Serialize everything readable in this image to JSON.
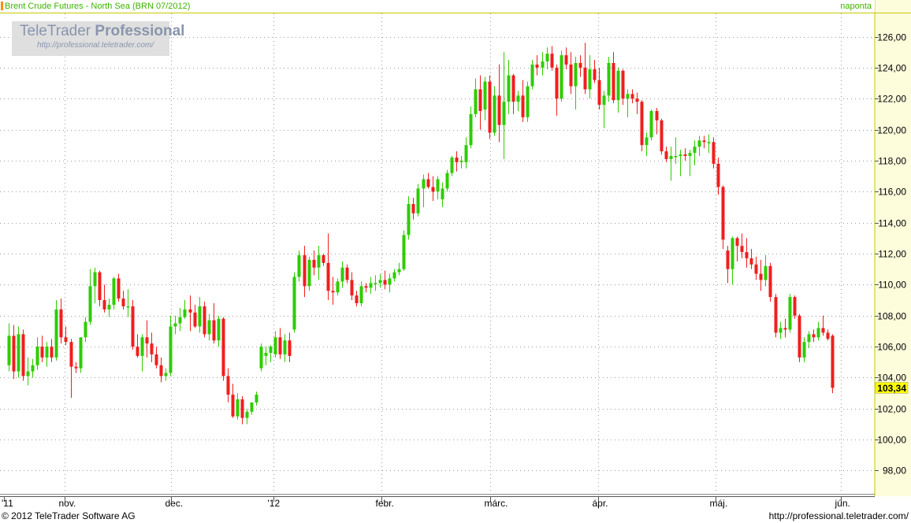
{
  "header": {
    "title": "Brent Crude Futures - North Sea (BRN 07/2012)",
    "frequency": "naponta"
  },
  "logo": {
    "name_light": "TeleTrader ",
    "name_bold": "Professional",
    "url": "http://professional.teletrader.com/"
  },
  "footer": {
    "copyright": "© 2012 TeleTrader Software AG",
    "url": "http://professional.teletrader.com/"
  },
  "colors": {
    "up": "#2ecc00",
    "down": "#f01e1e",
    "grid": "#9a9a9a",
    "axis_band": "#fdfddc",
    "axis_border": "#c8c800",
    "last_price_box": "#ffff00",
    "accent": "#ff8c00"
  },
  "chart_data": {
    "type": "candlestick",
    "title": "Brent Crude Futures - North Sea (BRN 07/2012)",
    "y_axis_side": "right",
    "ylim": [
      96.5,
      127.5
    ],
    "y_ticks": [
      "98,00",
      "100,00",
      "102,00",
      "104,00",
      "106,00",
      "108,00",
      "110,00",
      "112,00",
      "114,00",
      "116,00",
      "118,00",
      "120,00",
      "122,00",
      "124,00",
      "126,00"
    ],
    "x_ticks": [
      "'11",
      "nov.",
      "dec.",
      "'12",
      "febr.",
      "márc.",
      "ápr.",
      "máj.",
      "jún."
    ],
    "last_price": "103,34",
    "last_value": 103.34,
    "grid": true,
    "candles": [
      {
        "o": 104.8,
        "h": 107.5,
        "l": 104.4,
        "c": 106.7
      },
      {
        "o": 106.7,
        "h": 107.4,
        "l": 103.9,
        "c": 104.4
      },
      {
        "o": 104.4,
        "h": 107.3,
        "l": 104.0,
        "c": 106.8
      },
      {
        "o": 106.8,
        "h": 107.1,
        "l": 103.8,
        "c": 104.1
      },
      {
        "o": 104.1,
        "h": 105.3,
        "l": 103.5,
        "c": 104.4
      },
      {
        "o": 104.4,
        "h": 105.2,
        "l": 104.0,
        "c": 104.8
      },
      {
        "o": 104.8,
        "h": 106.6,
        "l": 104.5,
        "c": 106.0
      },
      {
        "o": 106.0,
        "h": 106.7,
        "l": 105.0,
        "c": 105.3
      },
      {
        "o": 105.3,
        "h": 106.3,
        "l": 104.7,
        "c": 106.0
      },
      {
        "o": 106.0,
        "h": 106.5,
        "l": 105.0,
        "c": 105.3
      },
      {
        "o": 105.3,
        "h": 109.0,
        "l": 105.1,
        "c": 108.4
      },
      {
        "o": 108.4,
        "h": 109.1,
        "l": 106.2,
        "c": 106.6
      },
      {
        "o": 106.6,
        "h": 107.3,
        "l": 106.1,
        "c": 106.3
      },
      {
        "o": 106.3,
        "h": 106.5,
        "l": 102.7,
        "c": 104.7
      },
      {
        "o": 104.7,
        "h": 105.0,
        "l": 104.3,
        "c": 104.6
      },
      {
        "o": 104.6,
        "h": 106.6,
        "l": 104.3,
        "c": 106.6
      },
      {
        "o": 106.6,
        "h": 107.9,
        "l": 106.3,
        "c": 107.6
      },
      {
        "o": 107.6,
        "h": 111.0,
        "l": 107.4,
        "c": 109.9
      },
      {
        "o": 109.9,
        "h": 111.1,
        "l": 108.8,
        "c": 110.8
      },
      {
        "o": 110.8,
        "h": 110.9,
        "l": 108.6,
        "c": 109.0
      },
      {
        "o": 109.0,
        "h": 110.0,
        "l": 108.2,
        "c": 108.4
      },
      {
        "o": 108.4,
        "h": 109.1,
        "l": 107.9,
        "c": 108.7
      },
      {
        "o": 108.7,
        "h": 110.5,
        "l": 108.4,
        "c": 110.4
      },
      {
        "o": 110.4,
        "h": 110.7,
        "l": 108.9,
        "c": 109.1
      },
      {
        "o": 109.1,
        "h": 109.6,
        "l": 108.4,
        "c": 108.6
      },
      {
        "o": 108.6,
        "h": 109.7,
        "l": 107.9,
        "c": 108.6
      },
      {
        "o": 108.6,
        "h": 109.0,
        "l": 105.8,
        "c": 106.0
      },
      {
        "o": 106.0,
        "h": 106.8,
        "l": 105.3,
        "c": 105.4
      },
      {
        "o": 105.4,
        "h": 106.8,
        "l": 104.4,
        "c": 106.6
      },
      {
        "o": 106.6,
        "h": 107.7,
        "l": 105.3,
        "c": 106.2
      },
      {
        "o": 106.2,
        "h": 106.9,
        "l": 105.0,
        "c": 105.5
      },
      {
        "o": 105.5,
        "h": 106.0,
        "l": 104.6,
        "c": 104.8
      },
      {
        "o": 104.8,
        "h": 105.3,
        "l": 103.7,
        "c": 104.1
      },
      {
        "o": 104.1,
        "h": 104.6,
        "l": 103.8,
        "c": 104.3
      },
      {
        "o": 104.3,
        "h": 108.0,
        "l": 104.1,
        "c": 107.3
      },
      {
        "o": 107.3,
        "h": 108.0,
        "l": 106.8,
        "c": 107.5
      },
      {
        "o": 107.5,
        "h": 108.5,
        "l": 107.0,
        "c": 107.9
      },
      {
        "o": 107.9,
        "h": 109.0,
        "l": 107.8,
        "c": 108.4
      },
      {
        "o": 108.4,
        "h": 109.3,
        "l": 107.0,
        "c": 108.2
      },
      {
        "o": 108.2,
        "h": 108.7,
        "l": 107.2,
        "c": 107.3
      },
      {
        "o": 107.3,
        "h": 109.2,
        "l": 106.9,
        "c": 108.6
      },
      {
        "o": 108.6,
        "h": 108.9,
        "l": 106.6,
        "c": 106.8
      },
      {
        "o": 106.8,
        "h": 108.1,
        "l": 106.4,
        "c": 107.7
      },
      {
        "o": 107.7,
        "h": 108.8,
        "l": 106.2,
        "c": 106.4
      },
      {
        "o": 106.4,
        "h": 108.0,
        "l": 106.0,
        "c": 107.8
      },
      {
        "o": 107.8,
        "h": 107.9,
        "l": 103.8,
        "c": 104.1
      },
      {
        "o": 104.1,
        "h": 104.6,
        "l": 102.4,
        "c": 102.9
      },
      {
        "o": 102.9,
        "h": 103.6,
        "l": 101.4,
        "c": 101.5
      },
      {
        "o": 101.5,
        "h": 103.0,
        "l": 101.3,
        "c": 102.6
      },
      {
        "o": 102.6,
        "h": 102.8,
        "l": 101.0,
        "c": 101.4
      },
      {
        "o": 101.4,
        "h": 102.0,
        "l": 101.0,
        "c": 101.8
      },
      {
        "o": 101.8,
        "h": 102.4,
        "l": 101.6,
        "c": 102.4
      },
      {
        "o": 102.4,
        "h": 103.1,
        "l": 102.2,
        "c": 102.9
      },
      {
        "o": 104.6,
        "h": 106.2,
        "l": 104.4,
        "c": 106.0
      },
      {
        "o": 105.4,
        "h": 106.0,
        "l": 104.8,
        "c": 105.6
      },
      {
        "o": 105.6,
        "h": 106.1,
        "l": 105.0,
        "c": 106.0
      },
      {
        "o": 105.5,
        "h": 107.0,
        "l": 105.3,
        "c": 106.6
      },
      {
        "o": 106.6,
        "h": 107.2,
        "l": 105.2,
        "c": 105.5
      },
      {
        "o": 105.5,
        "h": 106.8,
        "l": 105.0,
        "c": 106.4
      },
      {
        "o": 106.4,
        "h": 106.9,
        "l": 105.0,
        "c": 105.4
      },
      {
        "o": 107.1,
        "h": 110.8,
        "l": 106.9,
        "c": 110.5
      },
      {
        "o": 110.5,
        "h": 112.2,
        "l": 110.2,
        "c": 111.9
      },
      {
        "o": 111.9,
        "h": 112.5,
        "l": 109.2,
        "c": 109.9
      },
      {
        "o": 109.9,
        "h": 111.8,
        "l": 109.6,
        "c": 111.6
      },
      {
        "o": 111.6,
        "h": 112.2,
        "l": 110.6,
        "c": 111.1
      },
      {
        "o": 111.1,
        "h": 112.5,
        "l": 110.3,
        "c": 111.9
      },
      {
        "o": 111.9,
        "h": 112.0,
        "l": 111.2,
        "c": 111.4
      },
      {
        "o": 111.4,
        "h": 113.3,
        "l": 109.0,
        "c": 109.6
      },
      {
        "o": 109.6,
        "h": 110.5,
        "l": 108.7,
        "c": 109.5
      },
      {
        "o": 109.5,
        "h": 110.4,
        "l": 109.3,
        "c": 110.2
      },
      {
        "o": 110.2,
        "h": 111.5,
        "l": 109.8,
        "c": 111.1
      },
      {
        "o": 111.1,
        "h": 111.3,
        "l": 110.1,
        "c": 110.3
      },
      {
        "o": 110.3,
        "h": 110.8,
        "l": 109.0,
        "c": 109.3
      },
      {
        "o": 109.3,
        "h": 109.6,
        "l": 108.6,
        "c": 108.8
      },
      {
        "o": 108.8,
        "h": 110.2,
        "l": 108.6,
        "c": 109.9
      },
      {
        "o": 109.9,
        "h": 110.1,
        "l": 109.5,
        "c": 109.8
      },
      {
        "o": 109.8,
        "h": 110.5,
        "l": 109.4,
        "c": 110.1
      },
      {
        "o": 110.1,
        "h": 110.6,
        "l": 109.6,
        "c": 110.1
      },
      {
        "o": 110.1,
        "h": 110.7,
        "l": 109.8,
        "c": 110.3
      },
      {
        "o": 110.3,
        "h": 110.9,
        "l": 109.7,
        "c": 110.0
      },
      {
        "o": 110.0,
        "h": 110.7,
        "l": 109.5,
        "c": 110.4
      },
      {
        "o": 110.4,
        "h": 111.0,
        "l": 110.2,
        "c": 110.8
      },
      {
        "o": 110.8,
        "h": 111.4,
        "l": 110.6,
        "c": 111.0
      },
      {
        "o": 111.0,
        "h": 113.5,
        "l": 110.9,
        "c": 113.2
      },
      {
        "o": 113.2,
        "h": 115.7,
        "l": 112.9,
        "c": 115.2
      },
      {
        "o": 115.2,
        "h": 115.6,
        "l": 114.2,
        "c": 114.6
      },
      {
        "o": 114.6,
        "h": 116.5,
        "l": 114.4,
        "c": 116.2
      },
      {
        "o": 116.2,
        "h": 117.1,
        "l": 115.0,
        "c": 116.8
      },
      {
        "o": 116.8,
        "h": 117.2,
        "l": 116.2,
        "c": 116.3
      },
      {
        "o": 116.3,
        "h": 117.0,
        "l": 115.4,
        "c": 116.0
      },
      {
        "o": 116.0,
        "h": 117.0,
        "l": 115.5,
        "c": 116.8
      },
      {
        "o": 115.5,
        "h": 116.6,
        "l": 115.0,
        "c": 116.2
      },
      {
        "o": 116.2,
        "h": 117.4,
        "l": 116.0,
        "c": 117.2
      },
      {
        "o": 117.2,
        "h": 118.3,
        "l": 117.0,
        "c": 118.2
      },
      {
        "o": 118.2,
        "h": 118.6,
        "l": 117.3,
        "c": 117.9
      },
      {
        "o": 117.9,
        "h": 118.3,
        "l": 117.5,
        "c": 118.0
      },
      {
        "o": 117.9,
        "h": 119.5,
        "l": 117.5,
        "c": 119.0
      },
      {
        "o": 119.0,
        "h": 121.5,
        "l": 118.8,
        "c": 121.0
      },
      {
        "o": 121.0,
        "h": 123.3,
        "l": 120.8,
        "c": 122.6
      },
      {
        "o": 122.6,
        "h": 123.5,
        "l": 120.0,
        "c": 121.2
      },
      {
        "o": 121.3,
        "h": 123.4,
        "l": 120.6,
        "c": 123.1
      },
      {
        "o": 123.1,
        "h": 123.5,
        "l": 119.4,
        "c": 119.8
      },
      {
        "o": 119.8,
        "h": 122.8,
        "l": 119.6,
        "c": 122.2
      },
      {
        "o": 122.2,
        "h": 124.2,
        "l": 119.2,
        "c": 120.3
      },
      {
        "o": 120.3,
        "h": 125.0,
        "l": 118.1,
        "c": 121.8
      },
      {
        "o": 121.8,
        "h": 124.5,
        "l": 121.0,
        "c": 123.5
      },
      {
        "o": 123.5,
        "h": 123.6,
        "l": 121.0,
        "c": 121.8
      },
      {
        "o": 121.8,
        "h": 122.5,
        "l": 121.2,
        "c": 122.2
      },
      {
        "o": 122.2,
        "h": 123.2,
        "l": 120.5,
        "c": 120.8
      },
      {
        "o": 120.8,
        "h": 123.1,
        "l": 120.5,
        "c": 122.8
      },
      {
        "o": 122.8,
        "h": 124.5,
        "l": 122.6,
        "c": 124.2
      },
      {
        "o": 124.2,
        "h": 124.8,
        "l": 123.5,
        "c": 124.0
      },
      {
        "o": 124.0,
        "h": 125.0,
        "l": 123.5,
        "c": 124.4
      },
      {
        "o": 124.4,
        "h": 125.3,
        "l": 123.9,
        "c": 124.9
      },
      {
        "o": 124.9,
        "h": 125.4,
        "l": 123.8,
        "c": 124.0
      },
      {
        "o": 124.0,
        "h": 124.2,
        "l": 120.9,
        "c": 122.0
      },
      {
        "o": 122.0,
        "h": 125.1,
        "l": 121.8,
        "c": 124.8
      },
      {
        "o": 124.8,
        "h": 125.3,
        "l": 123.9,
        "c": 124.2
      },
      {
        "o": 124.2,
        "h": 125.0,
        "l": 122.3,
        "c": 122.8
      },
      {
        "o": 122.8,
        "h": 124.7,
        "l": 121.3,
        "c": 124.3
      },
      {
        "o": 124.3,
        "h": 124.8,
        "l": 123.4,
        "c": 124.0
      },
      {
        "o": 124.0,
        "h": 125.6,
        "l": 122.3,
        "c": 122.6
      },
      {
        "o": 122.6,
        "h": 124.8,
        "l": 122.0,
        "c": 123.9
      },
      {
        "o": 123.9,
        "h": 124.5,
        "l": 123.0,
        "c": 123.2
      },
      {
        "o": 123.2,
        "h": 124.0,
        "l": 121.3,
        "c": 121.6
      },
      {
        "o": 121.6,
        "h": 122.5,
        "l": 120.1,
        "c": 122.2
      },
      {
        "o": 122.2,
        "h": 124.7,
        "l": 121.8,
        "c": 124.3
      },
      {
        "o": 124.3,
        "h": 125.0,
        "l": 121.7,
        "c": 121.9
      },
      {
        "o": 121.9,
        "h": 124.0,
        "l": 121.1,
        "c": 123.8
      },
      {
        "o": 123.8,
        "h": 123.9,
        "l": 121.6,
        "c": 122.0
      },
      {
        "o": 122.0,
        "h": 122.6,
        "l": 120.8,
        "c": 122.3
      },
      {
        "o": 122.3,
        "h": 122.6,
        "l": 121.7,
        "c": 122.0
      },
      {
        "o": 122.0,
        "h": 122.4,
        "l": 121.0,
        "c": 121.8
      },
      {
        "o": 121.8,
        "h": 121.9,
        "l": 118.6,
        "c": 119.0
      },
      {
        "o": 119.0,
        "h": 119.8,
        "l": 118.3,
        "c": 119.5
      },
      {
        "o": 119.5,
        "h": 121.3,
        "l": 119.3,
        "c": 121.2
      },
      {
        "o": 121.2,
        "h": 121.4,
        "l": 119.7,
        "c": 120.6
      },
      {
        "o": 120.6,
        "h": 120.7,
        "l": 118.4,
        "c": 118.6
      },
      {
        "o": 118.6,
        "h": 118.9,
        "l": 117.9,
        "c": 118.1
      },
      {
        "o": 118.1,
        "h": 118.9,
        "l": 116.7,
        "c": 118.3
      },
      {
        "o": 118.3,
        "h": 119.5,
        "l": 117.8,
        "c": 118.3
      },
      {
        "o": 118.3,
        "h": 118.7,
        "l": 117.0,
        "c": 118.4
      },
      {
        "o": 118.4,
        "h": 118.8,
        "l": 118.0,
        "c": 118.3
      },
      {
        "o": 118.3,
        "h": 118.7,
        "l": 117.0,
        "c": 118.5
      },
      {
        "o": 118.5,
        "h": 119.3,
        "l": 117.7,
        "c": 118.9
      },
      {
        "o": 118.9,
        "h": 119.6,
        "l": 118.3,
        "c": 119.3
      },
      {
        "o": 119.3,
        "h": 119.6,
        "l": 118.8,
        "c": 119.2
      },
      {
        "o": 119.2,
        "h": 119.7,
        "l": 118.5,
        "c": 119.2
      },
      {
        "o": 119.2,
        "h": 119.5,
        "l": 117.5,
        "c": 117.8
      },
      {
        "o": 117.8,
        "h": 118.2,
        "l": 115.8,
        "c": 116.3
      },
      {
        "o": 116.3,
        "h": 116.4,
        "l": 112.3,
        "c": 112.9
      },
      {
        "o": 112.2,
        "h": 112.5,
        "l": 110.1,
        "c": 111.0
      },
      {
        "o": 111.0,
        "h": 113.1,
        "l": 110.0,
        "c": 113.0
      },
      {
        "o": 113.0,
        "h": 113.1,
        "l": 111.5,
        "c": 112.5
      },
      {
        "o": 112.5,
        "h": 113.3,
        "l": 111.7,
        "c": 112.1
      },
      {
        "o": 112.1,
        "h": 113.0,
        "l": 111.1,
        "c": 111.7
      },
      {
        "o": 111.7,
        "h": 112.3,
        "l": 111.0,
        "c": 111.3
      },
      {
        "o": 111.3,
        "h": 111.8,
        "l": 110.3,
        "c": 110.7
      },
      {
        "o": 110.7,
        "h": 111.6,
        "l": 109.6,
        "c": 110.3
      },
      {
        "o": 110.3,
        "h": 111.9,
        "l": 109.9,
        "c": 111.2
      },
      {
        "o": 111.2,
        "h": 111.4,
        "l": 108.9,
        "c": 109.2
      },
      {
        "o": 109.2,
        "h": 109.4,
        "l": 106.6,
        "c": 106.9
      },
      {
        "o": 106.9,
        "h": 107.6,
        "l": 106.5,
        "c": 107.2
      },
      {
        "o": 107.2,
        "h": 107.8,
        "l": 106.6,
        "c": 107.1
      },
      {
        "o": 107.1,
        "h": 109.4,
        "l": 106.9,
        "c": 109.2
      },
      {
        "o": 109.2,
        "h": 109.3,
        "l": 107.8,
        "c": 108.0
      },
      {
        "o": 108.0,
        "h": 108.1,
        "l": 105.0,
        "c": 105.3
      },
      {
        "o": 105.3,
        "h": 106.6,
        "l": 105.0,
        "c": 106.3
      },
      {
        "o": 106.3,
        "h": 107.0,
        "l": 105.9,
        "c": 106.8
      },
      {
        "o": 106.8,
        "h": 107.1,
        "l": 106.3,
        "c": 106.6
      },
      {
        "o": 106.6,
        "h": 107.6,
        "l": 106.4,
        "c": 107.2
      },
      {
        "o": 107.2,
        "h": 108.0,
        "l": 106.7,
        "c": 106.9
      },
      {
        "o": 106.9,
        "h": 107.1,
        "l": 106.4,
        "c": 106.5
      },
      {
        "o": 106.7,
        "h": 106.8,
        "l": 103.0,
        "c": 103.34
      }
    ]
  }
}
